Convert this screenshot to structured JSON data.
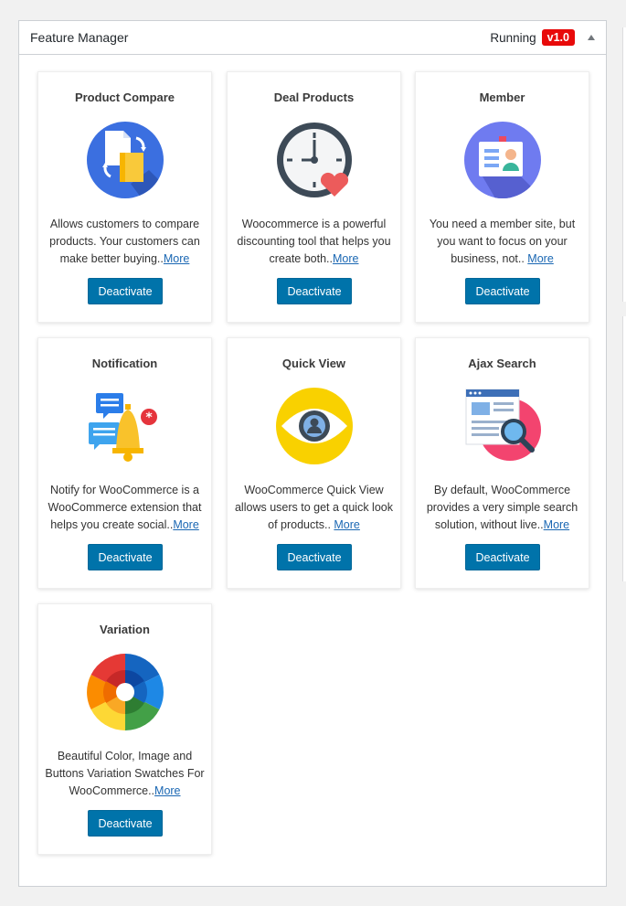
{
  "panel": {
    "title": "Feature Manager",
    "status": "Running",
    "version": "v1.0"
  },
  "features": [
    {
      "title": "Product Compare",
      "icon": "product-compare-icon",
      "desc": "Allows customers to compare products. Your customers can make better buying..",
      "more": "More",
      "button": "Deactivate"
    },
    {
      "title": "Deal Products",
      "icon": "clock-heart-icon",
      "desc": "Woocommerce is a powerful discounting tool that helps you create both..",
      "more": "More",
      "button": "Deactivate"
    },
    {
      "title": "Member",
      "icon": "id-badge-icon",
      "desc": "You need a member site, but you want to focus on your business, not.. ",
      "more": "More",
      "button": "Deactivate"
    },
    {
      "title": "Notification",
      "icon": "notification-bell-icon",
      "desc": "Notify for WooCommerce is a WooCommerce extension that helps you create social..",
      "more": "More",
      "button": "Deactivate"
    },
    {
      "title": "Quick View",
      "icon": "eye-icon",
      "desc": "WooCommerce Quick View allows users to get a quick look of products.. ",
      "more": "More",
      "button": "Deactivate"
    },
    {
      "title": "Ajax Search",
      "icon": "search-page-icon",
      "desc": "By default, WooCommerce provides a very simple search solution, without live..",
      "more": "More",
      "button": "Deactivate"
    },
    {
      "title": "Variation",
      "icon": "color-wheel-icon",
      "desc": "Beautiful Color, Image and Buttons Variation Swatches For WooCommerce..",
      "more": "More",
      "button": "Deactivate"
    }
  ],
  "colors": {
    "badge": "#e80a0a",
    "button": "#0073aa",
    "link": "#1a67b3"
  }
}
